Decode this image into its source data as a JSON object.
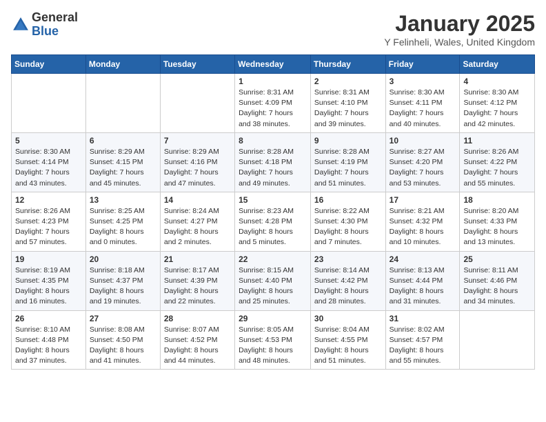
{
  "logo": {
    "general": "General",
    "blue": "Blue"
  },
  "title": "January 2025",
  "subtitle": "Y Felinheli, Wales, United Kingdom",
  "weekdays": [
    "Sunday",
    "Monday",
    "Tuesday",
    "Wednesday",
    "Thursday",
    "Friday",
    "Saturday"
  ],
  "weeks": [
    [
      {
        "day": "",
        "info": ""
      },
      {
        "day": "",
        "info": ""
      },
      {
        "day": "",
        "info": ""
      },
      {
        "day": "1",
        "info": "Sunrise: 8:31 AM\nSunset: 4:09 PM\nDaylight: 7 hours and 38 minutes."
      },
      {
        "day": "2",
        "info": "Sunrise: 8:31 AM\nSunset: 4:10 PM\nDaylight: 7 hours and 39 minutes."
      },
      {
        "day": "3",
        "info": "Sunrise: 8:30 AM\nSunset: 4:11 PM\nDaylight: 7 hours and 40 minutes."
      },
      {
        "day": "4",
        "info": "Sunrise: 8:30 AM\nSunset: 4:12 PM\nDaylight: 7 hours and 42 minutes."
      }
    ],
    [
      {
        "day": "5",
        "info": "Sunrise: 8:30 AM\nSunset: 4:14 PM\nDaylight: 7 hours and 43 minutes."
      },
      {
        "day": "6",
        "info": "Sunrise: 8:29 AM\nSunset: 4:15 PM\nDaylight: 7 hours and 45 minutes."
      },
      {
        "day": "7",
        "info": "Sunrise: 8:29 AM\nSunset: 4:16 PM\nDaylight: 7 hours and 47 minutes."
      },
      {
        "day": "8",
        "info": "Sunrise: 8:28 AM\nSunset: 4:18 PM\nDaylight: 7 hours and 49 minutes."
      },
      {
        "day": "9",
        "info": "Sunrise: 8:28 AM\nSunset: 4:19 PM\nDaylight: 7 hours and 51 minutes."
      },
      {
        "day": "10",
        "info": "Sunrise: 8:27 AM\nSunset: 4:20 PM\nDaylight: 7 hours and 53 minutes."
      },
      {
        "day": "11",
        "info": "Sunrise: 8:26 AM\nSunset: 4:22 PM\nDaylight: 7 hours and 55 minutes."
      }
    ],
    [
      {
        "day": "12",
        "info": "Sunrise: 8:26 AM\nSunset: 4:23 PM\nDaylight: 7 hours and 57 minutes."
      },
      {
        "day": "13",
        "info": "Sunrise: 8:25 AM\nSunset: 4:25 PM\nDaylight: 8 hours and 0 minutes."
      },
      {
        "day": "14",
        "info": "Sunrise: 8:24 AM\nSunset: 4:27 PM\nDaylight: 8 hours and 2 minutes."
      },
      {
        "day": "15",
        "info": "Sunrise: 8:23 AM\nSunset: 4:28 PM\nDaylight: 8 hours and 5 minutes."
      },
      {
        "day": "16",
        "info": "Sunrise: 8:22 AM\nSunset: 4:30 PM\nDaylight: 8 hours and 7 minutes."
      },
      {
        "day": "17",
        "info": "Sunrise: 8:21 AM\nSunset: 4:32 PM\nDaylight: 8 hours and 10 minutes."
      },
      {
        "day": "18",
        "info": "Sunrise: 8:20 AM\nSunset: 4:33 PM\nDaylight: 8 hours and 13 minutes."
      }
    ],
    [
      {
        "day": "19",
        "info": "Sunrise: 8:19 AM\nSunset: 4:35 PM\nDaylight: 8 hours and 16 minutes."
      },
      {
        "day": "20",
        "info": "Sunrise: 8:18 AM\nSunset: 4:37 PM\nDaylight: 8 hours and 19 minutes."
      },
      {
        "day": "21",
        "info": "Sunrise: 8:17 AM\nSunset: 4:39 PM\nDaylight: 8 hours and 22 minutes."
      },
      {
        "day": "22",
        "info": "Sunrise: 8:15 AM\nSunset: 4:40 PM\nDaylight: 8 hours and 25 minutes."
      },
      {
        "day": "23",
        "info": "Sunrise: 8:14 AM\nSunset: 4:42 PM\nDaylight: 8 hours and 28 minutes."
      },
      {
        "day": "24",
        "info": "Sunrise: 8:13 AM\nSunset: 4:44 PM\nDaylight: 8 hours and 31 minutes."
      },
      {
        "day": "25",
        "info": "Sunrise: 8:11 AM\nSunset: 4:46 PM\nDaylight: 8 hours and 34 minutes."
      }
    ],
    [
      {
        "day": "26",
        "info": "Sunrise: 8:10 AM\nSunset: 4:48 PM\nDaylight: 8 hours and 37 minutes."
      },
      {
        "day": "27",
        "info": "Sunrise: 8:08 AM\nSunset: 4:50 PM\nDaylight: 8 hours and 41 minutes."
      },
      {
        "day": "28",
        "info": "Sunrise: 8:07 AM\nSunset: 4:52 PM\nDaylight: 8 hours and 44 minutes."
      },
      {
        "day": "29",
        "info": "Sunrise: 8:05 AM\nSunset: 4:53 PM\nDaylight: 8 hours and 48 minutes."
      },
      {
        "day": "30",
        "info": "Sunrise: 8:04 AM\nSunset: 4:55 PM\nDaylight: 8 hours and 51 minutes."
      },
      {
        "day": "31",
        "info": "Sunrise: 8:02 AM\nSunset: 4:57 PM\nDaylight: 8 hours and 55 minutes."
      },
      {
        "day": "",
        "info": ""
      }
    ]
  ]
}
